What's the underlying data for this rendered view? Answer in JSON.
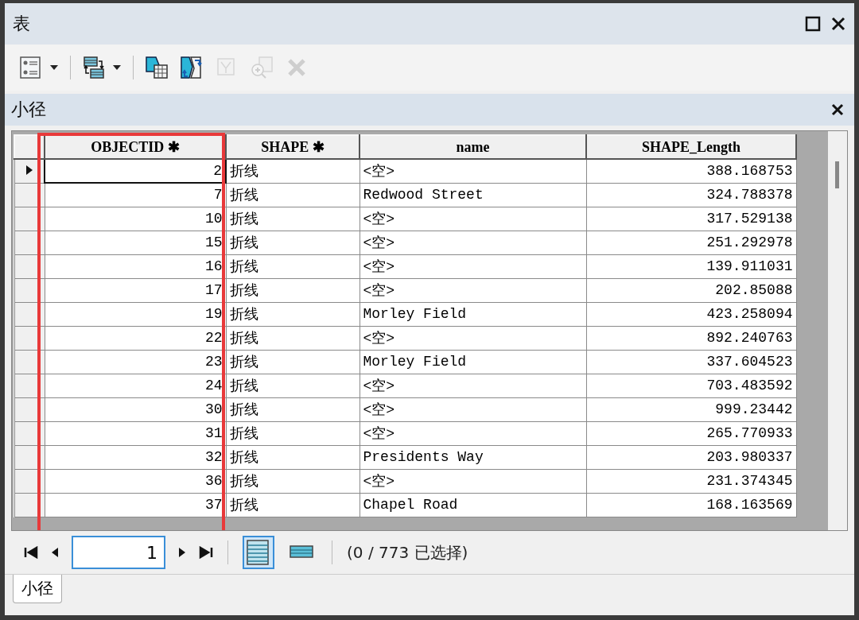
{
  "window": {
    "title": "表"
  },
  "toolbar": [
    {
      "kind": "options",
      "has_menu": true,
      "disabled": false
    },
    {
      "kind": "separator"
    },
    {
      "kind": "related",
      "has_menu": true,
      "disabled": false
    },
    {
      "kind": "separator"
    },
    {
      "kind": "select",
      "has_menu": false,
      "disabled": false
    },
    {
      "kind": "switch",
      "has_menu": false,
      "disabled": false
    },
    {
      "kind": "clear",
      "has_menu": false,
      "disabled": true
    },
    {
      "kind": "zoom",
      "has_menu": false,
      "disabled": true
    },
    {
      "kind": "delete",
      "has_menu": false,
      "disabled": true
    }
  ],
  "table_title": "小径",
  "columns": [
    {
      "label": "OBJECTID ✱",
      "highlighted": true
    },
    {
      "label": "SHAPE ✱",
      "highlighted": false
    },
    {
      "label": "name",
      "highlighted": false
    },
    {
      "label": "SHAPE_Length",
      "highlighted": false
    }
  ],
  "rows": [
    {
      "current": true,
      "cells": [
        "2",
        "折线",
        "<空>",
        "388.168753"
      ]
    },
    {
      "current": false,
      "cells": [
        "7",
        "折线",
        "Redwood Street",
        "324.788378"
      ]
    },
    {
      "current": false,
      "cells": [
        "10",
        "折线",
        "<空>",
        "317.529138"
      ]
    },
    {
      "current": false,
      "cells": [
        "15",
        "折线",
        "<空>",
        "251.292978"
      ]
    },
    {
      "current": false,
      "cells": [
        "16",
        "折线",
        "<空>",
        "139.911031"
      ]
    },
    {
      "current": false,
      "cells": [
        "17",
        "折线",
        "<空>",
        "202.85088"
      ]
    },
    {
      "current": false,
      "cells": [
        "19",
        "折线",
        "Morley Field",
        "423.258094"
      ]
    },
    {
      "current": false,
      "cells": [
        "22",
        "折线",
        "<空>",
        "892.240763"
      ]
    },
    {
      "current": false,
      "cells": [
        "23",
        "折线",
        "Morley Field",
        "337.604523"
      ]
    },
    {
      "current": false,
      "cells": [
        "24",
        "折线",
        "<空>",
        "703.483592"
      ]
    },
    {
      "current": false,
      "cells": [
        "30",
        "折线",
        "<空>",
        "999.23442"
      ]
    },
    {
      "current": false,
      "cells": [
        "31",
        "折线",
        "<空>",
        "265.770933"
      ]
    },
    {
      "current": false,
      "cells": [
        "32",
        "折线",
        "Presidents Way",
        "203.980337"
      ]
    },
    {
      "current": false,
      "cells": [
        "36",
        "折线",
        "<空>",
        "231.374345"
      ]
    },
    {
      "current": false,
      "cells": [
        "37",
        "折线",
        "Chapel Road",
        "168.163569"
      ]
    }
  ],
  "navigation": {
    "record": "1",
    "views": [
      {
        "kind": "all",
        "selected": true
      },
      {
        "kind": "selected",
        "selected": false
      }
    ],
    "status": "(0 / 773 已选择)"
  },
  "tabs": [
    {
      "label": "小径",
      "selected": true
    }
  ]
}
